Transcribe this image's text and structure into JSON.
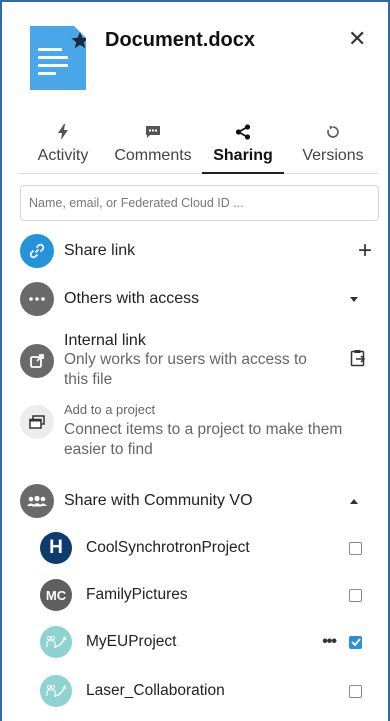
{
  "header": {
    "title": "Document.docx",
    "close_icon": "close-icon",
    "file_icon": "document-starred-icon",
    "file_color": "#49a6e9"
  },
  "tabs": [
    {
      "label": "Activity",
      "icon": "activity-bolt-icon",
      "active": false
    },
    {
      "label": "Comments",
      "icon": "comment-icon",
      "active": false
    },
    {
      "label": "Sharing",
      "icon": "share-icon",
      "active": true
    },
    {
      "label": "Versions",
      "icon": "history-icon",
      "active": false
    }
  ],
  "search": {
    "placeholder": "Name, email, or Federated Cloud ID ..."
  },
  "share_link": {
    "label": "Share link",
    "icon": "link-icon",
    "action_icon": "plus-icon"
  },
  "others_access": {
    "label": "Others with access",
    "icon": "more-horizontal-icon",
    "action_icon": "chevron-down-icon"
  },
  "internal_link": {
    "label": "Internal link",
    "description": "Only works for users with access to this file",
    "icon": "external-link-icon",
    "action_icon": "clipboard-copy-icon"
  },
  "project": {
    "title": "Add to a project",
    "description": "Connect items to a project to make them easier to find",
    "icon": "projects-icon"
  },
  "community": {
    "label": "Share with Community VO",
    "icon": "group-icon",
    "action_icon": "chevron-up-icon",
    "groups": [
      {
        "name": "CoolSynchrotronProject",
        "avatar": "H",
        "color": "#0e3b6e",
        "checked": false,
        "dots": false
      },
      {
        "name": "FamilyPictures",
        "avatar": "MC",
        "color": "#5f5f5f",
        "checked": false,
        "dots": false
      },
      {
        "name": "MyEUProject",
        "avatar": "",
        "color": "#8fd3d0",
        "checked": true,
        "dots": true
      },
      {
        "name": "Laser_Collaboration",
        "avatar": "",
        "color": "#8fd3d0",
        "checked": false,
        "dots": false
      }
    ]
  }
}
